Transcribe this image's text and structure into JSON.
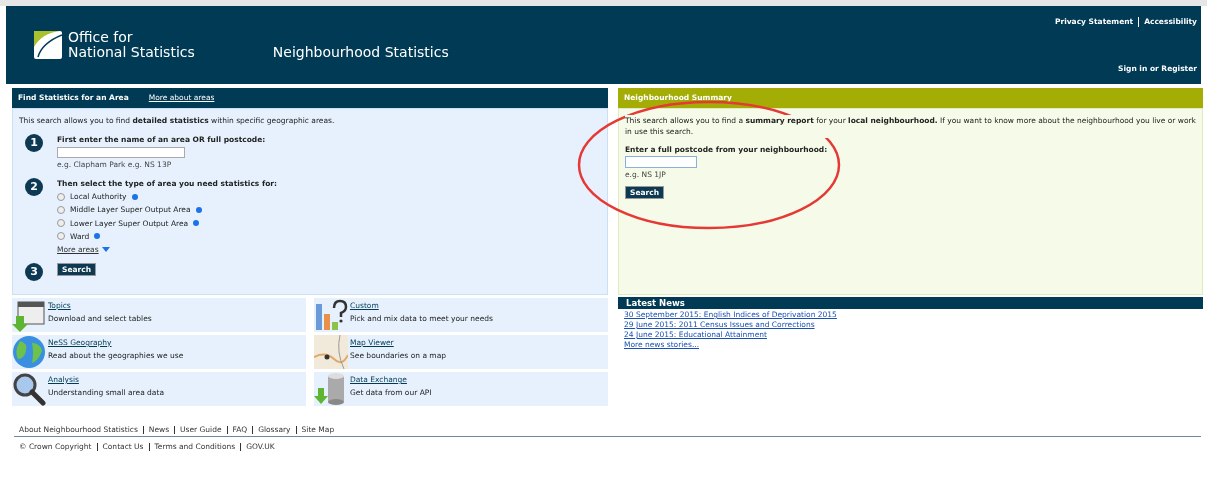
{
  "header": {
    "logo_line_1": "Office for",
    "logo_line_2": "National Statistics",
    "site_title": "Neighbourhood Statistics",
    "top_links": [
      "Privacy Statement",
      "Accessibility"
    ],
    "sign_in": "Sign in or Register"
  },
  "find_panel": {
    "title": "Find Statistics for an Area",
    "title_link": "More about areas",
    "intro": "This search allows you to find **detailed statistics** within specific geographic areas.",
    "steps": [
      {
        "number": "1",
        "label": "First enter the name of an area OR full postcode:",
        "hint": "e.g. Clapham Park e.g. NS 13P"
      },
      {
        "number": "2",
        "label": "Then select the type of area you need statistics for:"
      },
      {
        "number": "3"
      }
    ],
    "area_types": [
      {
        "label": "Local Authority",
        "selected": false
      },
      {
        "label": "Middle Layer Super Output Area",
        "selected": false
      },
      {
        "label": "Lower Layer Super Output Area",
        "selected": false
      },
      {
        "label": "Ward",
        "selected": false
      }
    ],
    "more_areas": "More areas",
    "search_button": "Search"
  },
  "summary_panel": {
    "title": "Neighbourhood Summary",
    "intro": "This search allows you to find a **summary report** for your **local neighbourhood.** If you want to know more about the neighbourhood you live or work in use this search.",
    "field_label": "Enter a full postcode from your neighbourhood:",
    "hint": "e.g. NS 1JP",
    "search_button": "Search"
  },
  "tiles": [
    {
      "title": "Topics",
      "description": "Download and select tables"
    },
    {
      "title": "Custom",
      "description": "Pick and mix data to meet your needs"
    },
    {
      "title": "NeSS Geography",
      "description": "Read about the geographies we use"
    },
    {
      "title": "Map Viewer",
      "description": "See boundaries on a map"
    },
    {
      "title": "Analysis",
      "description": "Understanding small area data"
    },
    {
      "title": "Data Exchange",
      "description": "Get data from our API"
    }
  ],
  "news": {
    "title": "Latest News",
    "items": [
      "30 September 2015: English Indices of Deprivation 2015",
      "29 June 2015: 2011 Census Issues and Corrections",
      "24 June 2015: Educational Attainment"
    ],
    "more": "More news stories..."
  },
  "footer": {
    "links": [
      "About Neighbourhood Statistics",
      "News",
      "User Guide",
      "FAQ",
      "Glossary",
      "Site Map"
    ],
    "legal": [
      "© Crown Copyright",
      "Contact Us",
      "Terms and Conditions",
      "GOV.UK"
    ]
  }
}
